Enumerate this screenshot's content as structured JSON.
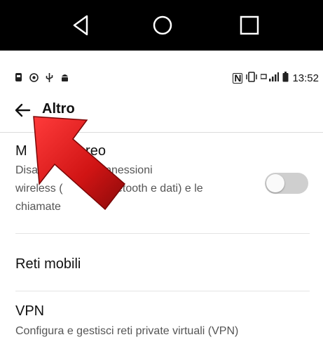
{
  "system_nav": {
    "back_icon": "triangle-back-icon",
    "home_icon": "circle-home-icon",
    "recents_icon": "square-recents-icon"
  },
  "status_bar": {
    "left_icons": [
      "notification-icon-1",
      "eye-icon",
      "usb-icon",
      "android-icon"
    ],
    "right_icons": [
      "nfc-icon",
      "vibrate-icon",
      "data-icon",
      "signal-icon",
      "battery-icon"
    ],
    "time": "13:52"
  },
  "app_bar": {
    "title": "Altro"
  },
  "settings": {
    "airplane": {
      "title": "Modalità aereo",
      "visible_title": "M           aereo",
      "description_line1": "Disatt            le connessioni",
      "description_line2": "wireless (          , Bluetooth e dati) e le",
      "description_line3": "chiamate",
      "toggle_on": false
    },
    "mobile_networks": {
      "title": "Reti mobili"
    },
    "vpn": {
      "title": "VPN",
      "description": "Configura e gestisci reti private virtuali (VPN)"
    }
  },
  "colors": {
    "arrow": "#d21a1a",
    "toggle_track": "#cfcfcf",
    "navbar": "#000000"
  }
}
